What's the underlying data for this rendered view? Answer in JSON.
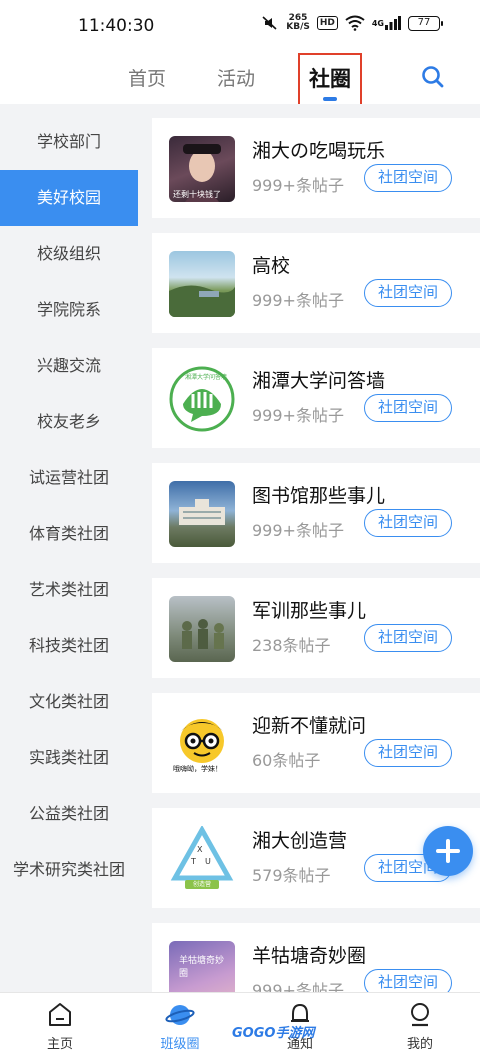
{
  "status_bar": {
    "time": "11:40:30",
    "speed_value": "265",
    "speed_unit": "KB/S",
    "hd": "HD",
    "network": "4G",
    "battery": "77"
  },
  "top_tabs": {
    "home": "首页",
    "activity": "活动",
    "community": "社圈"
  },
  "sidebar": {
    "items": [
      {
        "label": "学校部门"
      },
      {
        "label": "美好校园"
      },
      {
        "label": "校级组织"
      },
      {
        "label": "学院院系"
      },
      {
        "label": "兴趣交流"
      },
      {
        "label": "校友老乡"
      },
      {
        "label": "试运营社团"
      },
      {
        "label": "体育类社团"
      },
      {
        "label": "艺术类社团"
      },
      {
        "label": "科技类社团"
      },
      {
        "label": "文化类社团"
      },
      {
        "label": "实践类社团"
      },
      {
        "label": "公益类社团"
      },
      {
        "label": "学术研究类社团"
      }
    ],
    "selected_index": 1
  },
  "communities": [
    {
      "title": "湘大の吃喝玩乐",
      "count": "999+条帖子",
      "button": "社团空间",
      "thumb_caption": "还剩十块钱了"
    },
    {
      "title": "高校",
      "count": "999+条帖子",
      "button": "社团空间"
    },
    {
      "title": "湘潭大学问答墙",
      "count": "999+条帖子",
      "button": "社团空间",
      "thumb_caption": "湘潭大学问答墙"
    },
    {
      "title": "图书馆那些事儿",
      "count": "999+条帖子",
      "button": "社团空间"
    },
    {
      "title": "军训那些事儿",
      "count": "238条帖子",
      "button": "社团空间"
    },
    {
      "title": "迎新不懂就问",
      "count": "60条帖子",
      "button": "社团空间",
      "thumb_caption": "哦嗨呦，学妹！"
    },
    {
      "title": "湘大创造营",
      "count": "579条帖子",
      "button": "社团空间",
      "thumb_caption": "创造营"
    },
    {
      "title": "羊牯塘奇妙圈",
      "count": "999+条帖子",
      "button": "社团空间",
      "thumb_caption": "羊牯塘奇妙圈"
    }
  ],
  "bottom_nav": {
    "home": "主页",
    "class_circle": "班级圈",
    "notify": "通知",
    "mine": "我的"
  },
  "watermark": "GOGO手游网",
  "colors": {
    "accent": "#3a8ef0",
    "highlight_box": "#e0402a"
  }
}
